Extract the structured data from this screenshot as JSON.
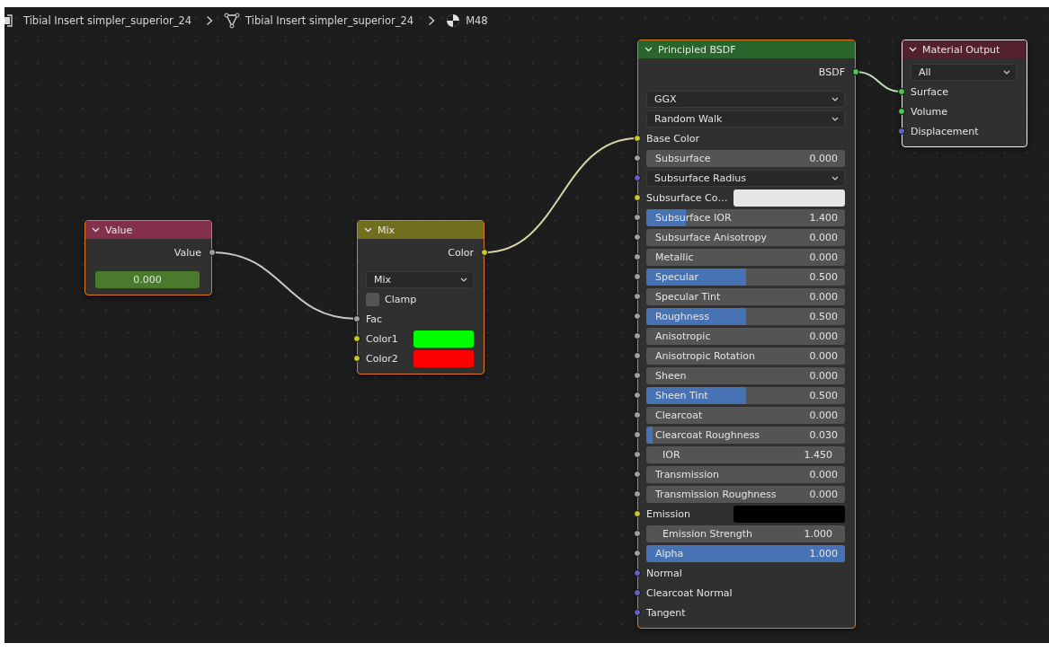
{
  "breadcrumbs": [
    {
      "label": "Tibial Insert simpler_superior_24"
    },
    {
      "label": "Tibial Insert simpler_superior_24"
    },
    {
      "label": "M48"
    }
  ],
  "nodes": [
    {
      "title": "Value",
      "color": "#83314a",
      "selected": true,
      "active": false,
      "rows": [
        {
          "kind": "output",
          "label": "Value",
          "socket": {
            "color": "#a1a1a1"
          }
        },
        {
          "kind": "number",
          "value": "0.000"
        }
      ]
    },
    {
      "title": "Mix",
      "color": "#6f6f1f",
      "selected": true,
      "active": false,
      "rows": [
        {
          "kind": "output",
          "label": "Color",
          "socket": {
            "color": "#c7c729"
          }
        },
        {
          "kind": "dropdown",
          "value": "Mix"
        },
        {
          "kind": "checkbox",
          "label": "Clamp",
          "checked": false
        },
        {
          "kind": "input",
          "label": "Fac",
          "socket": {
            "color": "#a1a1a1"
          }
        },
        {
          "kind": "color",
          "label": "Color1",
          "socket": {
            "color": "#c7c729"
          },
          "color": "#00ff00"
        },
        {
          "kind": "color",
          "label": "Color2",
          "socket": {
            "color": "#c7c729"
          },
          "color": "#ff0000"
        }
      ]
    },
    {
      "title": "Principled BSDF",
      "color": "#2a652b",
      "selected": true,
      "active": false,
      "rows": [
        {
          "kind": "output",
          "label": "BSDF",
          "socket": {
            "color": "#4fc74f"
          }
        },
        {
          "kind": "dropdown",
          "value": "GGX"
        },
        {
          "kind": "dropdown",
          "value": "Random Walk"
        },
        {
          "kind": "input",
          "label": "Base Color",
          "socket": {
            "color": "#c7c729"
          }
        },
        {
          "kind": "slider",
          "label": "Subsurface",
          "value": "0.000",
          "socket": {
            "color": "#a1a1a1"
          }
        },
        {
          "kind": "dropdown",
          "value": "Subsurface Radius",
          "socket": {
            "color": "#6363c7"
          }
        },
        {
          "kind": "color",
          "label": "Subsurface Co…",
          "socket": {
            "color": "#c7c729"
          },
          "color": "#e6e6e6"
        },
        {
          "kind": "slider",
          "label": "Subsurface IOR",
          "value": "1.400",
          "socket": {
            "color": "#a1a1a1"
          },
          "level": 0.2
        },
        {
          "kind": "slider",
          "label": "Subsurface Anisotropy",
          "value": "0.000",
          "socket": {
            "color": "#a1a1a1"
          }
        },
        {
          "kind": "slider",
          "label": "Metallic",
          "value": "0.000",
          "socket": {
            "color": "#a1a1a1"
          }
        },
        {
          "kind": "slider",
          "label": "Specular",
          "value": "0.500",
          "socket": {
            "color": "#a1a1a1"
          },
          "level": 0.5
        },
        {
          "kind": "slider",
          "label": "Specular Tint",
          "value": "0.000",
          "socket": {
            "color": "#a1a1a1"
          }
        },
        {
          "kind": "slider",
          "label": "Roughness",
          "value": "0.500",
          "socket": {
            "color": "#a1a1a1"
          },
          "level": 0.5
        },
        {
          "kind": "slider",
          "label": "Anisotropic",
          "value": "0.000",
          "socket": {
            "color": "#a1a1a1"
          }
        },
        {
          "kind": "slider",
          "label": "Anisotropic Rotation",
          "value": "0.000",
          "socket": {
            "color": "#a1a1a1"
          }
        },
        {
          "kind": "slider",
          "label": "Sheen",
          "value": "0.000",
          "socket": {
            "color": "#a1a1a1"
          }
        },
        {
          "kind": "slider",
          "label": "Sheen Tint",
          "value": "0.500",
          "socket": {
            "color": "#a1a1a1"
          },
          "level": 0.5
        },
        {
          "kind": "slider",
          "label": "Clearcoat",
          "value": "0.000",
          "socket": {
            "color": "#a1a1a1"
          }
        },
        {
          "kind": "slider",
          "label": "Clearcoat Roughness",
          "value": "0.030",
          "socket": {
            "color": "#a1a1a1"
          },
          "level": 0.03
        },
        {
          "kind": "value",
          "label": "IOR",
          "value": "1.450",
          "socket": {
            "color": "#a1a1a1"
          }
        },
        {
          "kind": "slider",
          "label": "Transmission",
          "value": "0.000",
          "socket": {
            "color": "#a1a1a1"
          }
        },
        {
          "kind": "slider",
          "label": "Transmission Roughness",
          "value": "0.000",
          "socket": {
            "color": "#a1a1a1"
          }
        },
        {
          "kind": "color",
          "label": "Emission",
          "socket": {
            "color": "#c7c729"
          },
          "color": "#000000"
        },
        {
          "kind": "value",
          "label": "Emission Strength",
          "value": "1.000",
          "socket": {
            "color": "#a1a1a1"
          }
        },
        {
          "kind": "slider",
          "label": "Alpha",
          "value": "1.000",
          "socket": {
            "color": "#a1a1a1"
          },
          "level": 1
        },
        {
          "kind": "input",
          "label": "Normal",
          "socket": {
            "color": "#6363c7"
          }
        },
        {
          "kind": "input",
          "label": "Clearcoat Normal",
          "socket": {
            "color": "#6363c7"
          }
        },
        {
          "kind": "input",
          "label": "Tangent",
          "socket": {
            "color": "#6363c7"
          }
        }
      ]
    },
    {
      "title": "Material Output",
      "color": "#52212c",
      "selected": false,
      "active": true,
      "rows": [
        {
          "kind": "dropdown",
          "value": "All"
        },
        {
          "kind": "input",
          "label": "Surface",
          "socket": {
            "color": "#4fc74f"
          }
        },
        {
          "kind": "input",
          "label": "Volume",
          "socket": {
            "color": "#4fc74f"
          }
        },
        {
          "kind": "input",
          "label": "Displacement",
          "socket": {
            "color": "#6363c7"
          }
        }
      ]
    }
  ]
}
